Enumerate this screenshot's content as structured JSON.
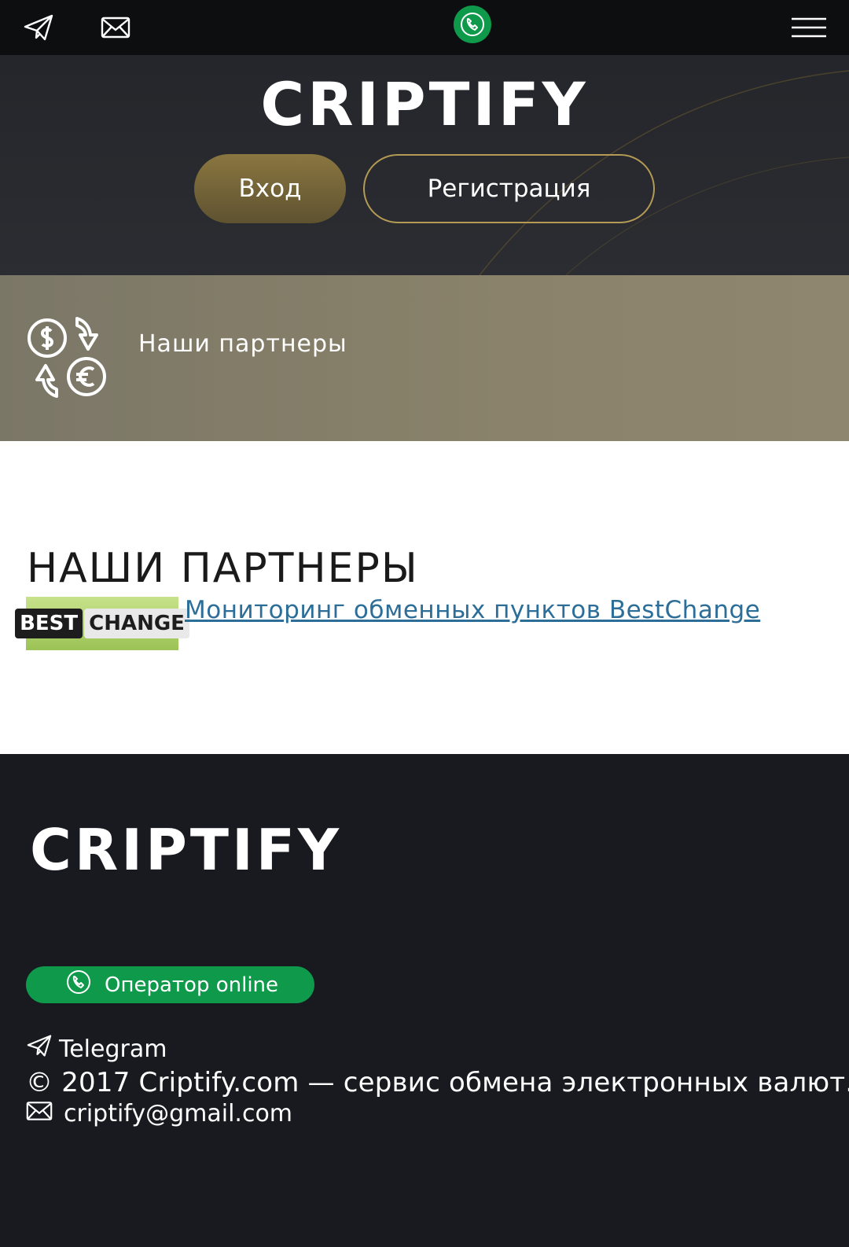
{
  "brand": {
    "logo_text": "CRIPTIFY"
  },
  "hero": {
    "login_label": "Вход",
    "register_label": "Регистрация"
  },
  "banner": {
    "title": "Наши партнеры"
  },
  "partners": {
    "heading": "НАШИ ПАРТНЕРЫ",
    "logo_best": "BEST",
    "logo_change": "CHANGE",
    "link_text": "Мониторинг обменных пунктов BestChange"
  },
  "footer": {
    "operator_label": "Оператор online",
    "telegram_label": "Telegram",
    "copyright": "© 2017 Criptify.com — сервис обмена электронных валют.",
    "email": "criptify@gmail.com"
  },
  "colors": {
    "accent_green": "#0f9a4b",
    "gold": "#b49a55",
    "link": "#2d6e99"
  },
  "icons": [
    "telegram-icon",
    "mail-icon",
    "phone-icon",
    "menu-icon",
    "currency-exchange-icon"
  ]
}
